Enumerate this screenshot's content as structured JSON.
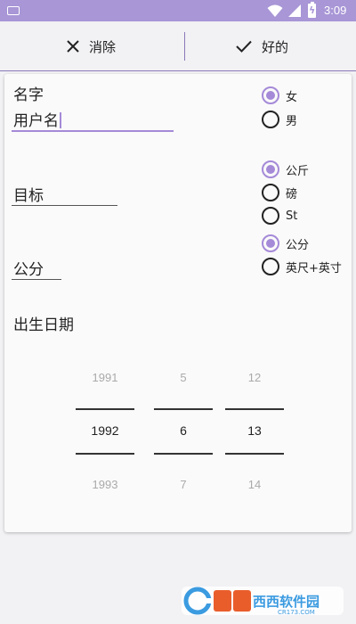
{
  "status_bar": {
    "time": "3:09"
  },
  "action_bar": {
    "cancel_label": "消除",
    "ok_label": "好的"
  },
  "form": {
    "name": {
      "label": "名字",
      "value": "用户名"
    },
    "gender": {
      "options": [
        {
          "label": "女",
          "checked": true
        },
        {
          "label": "男",
          "checked": false
        }
      ]
    },
    "goal": {
      "label": "目标",
      "value": ""
    },
    "weight_unit": {
      "options": [
        {
          "label": "公斤",
          "checked": true
        },
        {
          "label": "磅",
          "checked": false
        },
        {
          "label": "St",
          "checked": false
        }
      ]
    },
    "height": {
      "label": "公分",
      "value": ""
    },
    "height_unit": {
      "options": [
        {
          "label": "公分",
          "checked": true
        },
        {
          "label": "英尺+英寸",
          "checked": false
        }
      ]
    },
    "birthday": {
      "title": "出生日期",
      "year": {
        "prev": "1991",
        "current": "1992",
        "next": "1993"
      },
      "month": {
        "prev": "5",
        "current": "6",
        "next": "7"
      },
      "day": {
        "prev": "12",
        "current": "13",
        "next": "14"
      }
    }
  },
  "colors": {
    "accent": "#a58ad8",
    "status_bar": "#a896d6",
    "divider": "#8a7ab8"
  },
  "watermark": {
    "brand": "西西软件园",
    "url": "CR173.COM"
  }
}
